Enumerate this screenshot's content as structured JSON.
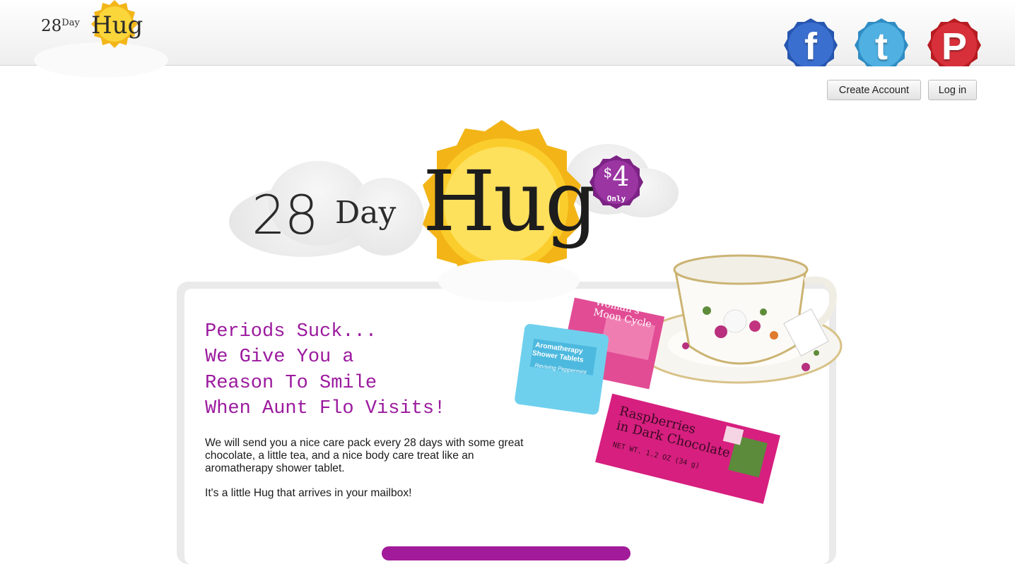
{
  "header": {
    "logo": {
      "number": "28",
      "day": "Day",
      "hug": "Hug"
    },
    "social": [
      {
        "name": "facebook",
        "glyph": "f",
        "color": "#2f5fb8"
      },
      {
        "name": "twitter",
        "glyph": "t",
        "color": "#3d9bd2"
      },
      {
        "name": "pinterest",
        "glyph": "P",
        "color": "#cc2127"
      }
    ]
  },
  "auth": {
    "create_account": "Create Account",
    "log_in": "Log in"
  },
  "hero": {
    "number": "28",
    "day": "Day",
    "hug": "Hug",
    "price_currency": "$",
    "price_amount": "4",
    "price_note": "Only"
  },
  "content": {
    "headline": [
      "Periods Suck...",
      "We Give You a",
      "Reason To Smile",
      "When Aunt Flo Visits!"
    ],
    "body": "We will send you a nice care pack every 28 days with some great chocolate, a little tea, and a nice body care treat like an aromatherapy shower tablet.",
    "tagline": "It's a little Hug that arrives in your mailbox!"
  },
  "products": {
    "tea_label": "Woman's Moon Cycle",
    "shower_label": "Aromatherapy Shower Tablets",
    "shower_sub": "Reviving Peppermint",
    "chocolate_label_1": "Raspberries",
    "chocolate_label_2": "in Dark Chocolate",
    "chocolate_weight": "NET WT. 1.2 OZ (34 g)"
  },
  "colors": {
    "accent_purple": "#9b1a9e",
    "sun_yellow": "#f7c21b",
    "price_purple": "#8e2a94"
  }
}
